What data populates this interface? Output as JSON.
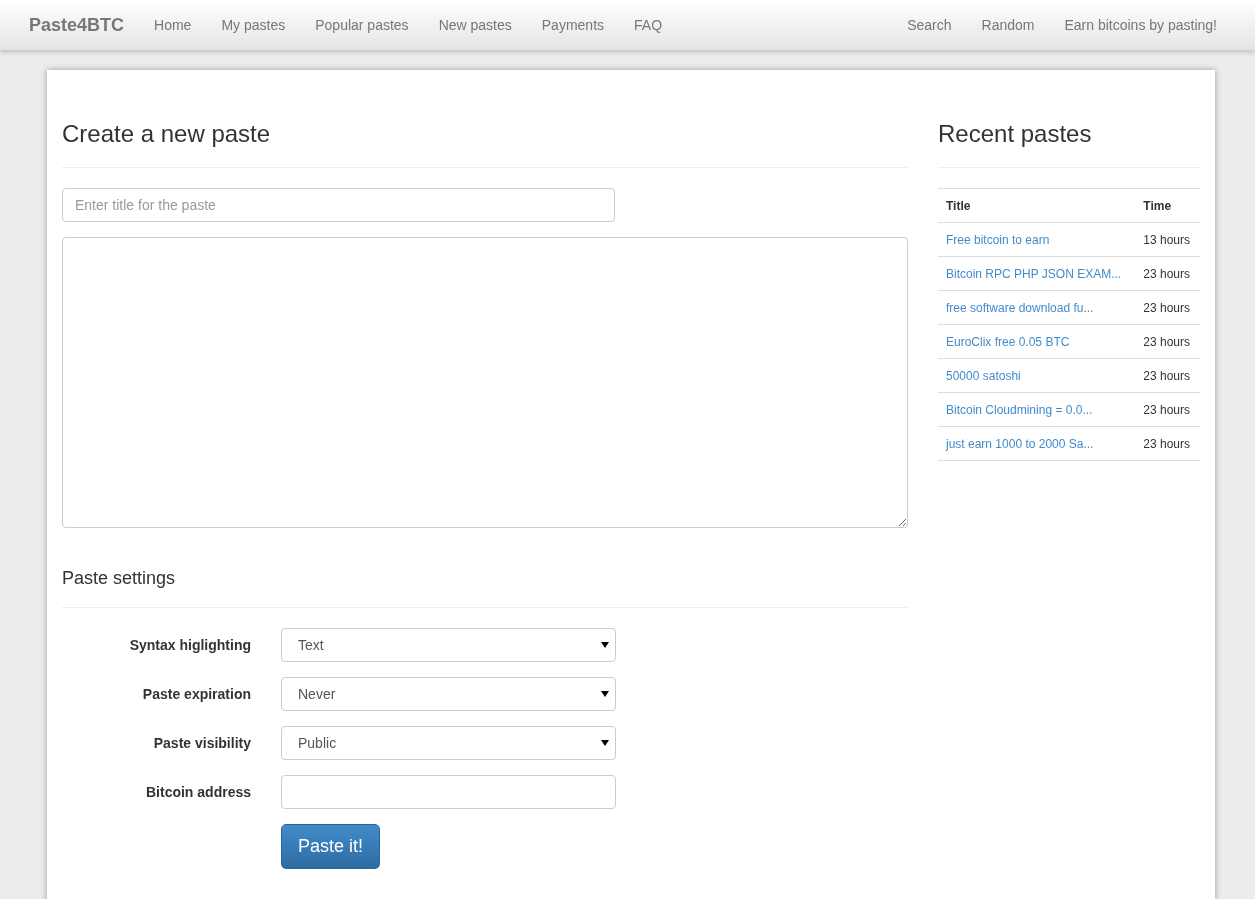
{
  "navbar": {
    "brand": "Paste4BTC",
    "left_links": [
      "Home",
      "My pastes",
      "Popular pastes",
      "New pastes",
      "Payments",
      "FAQ"
    ],
    "right_links": [
      "Search",
      "Random",
      "Earn bitcoins by pasting!"
    ]
  },
  "create": {
    "heading": "Create a new paste",
    "title_field": {
      "placeholder": "Enter title for the paste"
    },
    "settings_heading": "Paste settings",
    "settings": [
      {
        "kind": "select",
        "label": "Syntax higlighting",
        "value": "Text"
      },
      {
        "kind": "select",
        "label": "Paste expiration",
        "value": "Never"
      },
      {
        "kind": "select",
        "label": "Paste visibility",
        "value": "Public"
      },
      {
        "kind": "input",
        "label": "Bitcoin address"
      }
    ],
    "submit": "Paste it!"
  },
  "recent": {
    "heading": "Recent pastes",
    "columns": [
      "Title",
      "Time"
    ],
    "rows": [
      {
        "title": "Free bitcoin to earn",
        "time": "13 hours"
      },
      {
        "title": "Bitcoin RPC PHP JSON EXAM...",
        "time": "23 hours"
      },
      {
        "title": "free software download fu...",
        "time": "23 hours"
      },
      {
        "title": "EuroClix free 0.05 BTC",
        "time": "23 hours"
      },
      {
        "title": "50000 satoshi",
        "time": "23 hours"
      },
      {
        "title": "Bitcoin Cloudmining = 0.0...",
        "time": "23 hours"
      },
      {
        "title": "just earn 1000 to 2000 Sa...",
        "time": "23 hours"
      }
    ]
  }
}
